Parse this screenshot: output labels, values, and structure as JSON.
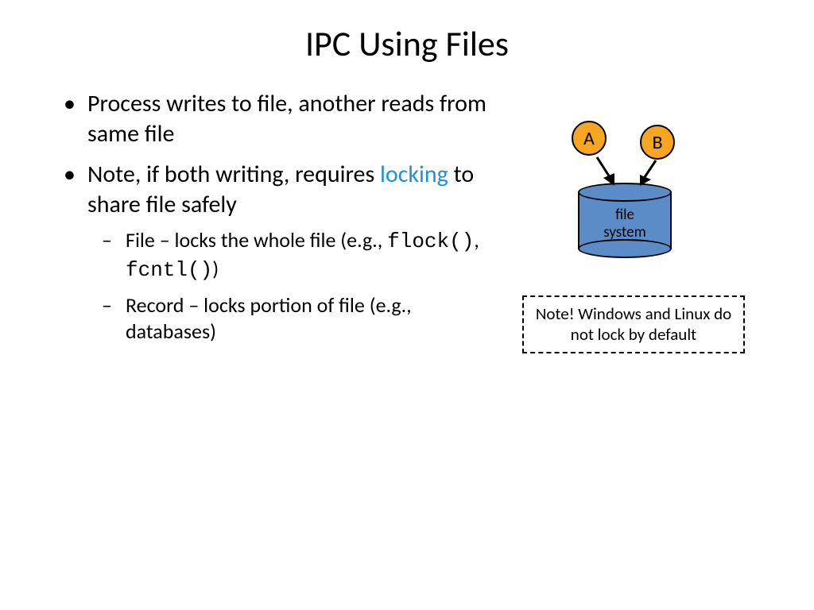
{
  "title": "IPC Using Files",
  "bullets": {
    "b1": "Process writes to file, another reads from same file",
    "b2_pre": "Note, if both writing, requires ",
    "b2_hl": "locking",
    "b2_post": " to share file safely",
    "s1_pre": "File – locks the whole file (e.g., ",
    "s1_c1": "flock()",
    "s1_mid": ", ",
    "s1_c2": "fcntl()",
    "s1_post": ")",
    "s2": "Record – locks portion of file (e.g., databases)"
  },
  "diagram": {
    "procA": "A",
    "procB": "B",
    "cylLabel1": "file",
    "cylLabel2": "system"
  },
  "note": "Note! Windows and Linux do not lock by default"
}
